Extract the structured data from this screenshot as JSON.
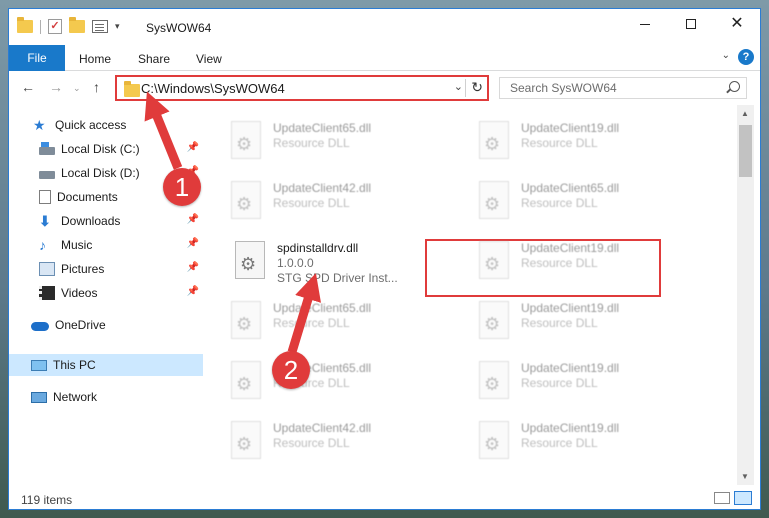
{
  "window": {
    "title": "SysWOW64",
    "controls": {
      "minimize": "—",
      "maximize": "☐",
      "close": "✕"
    }
  },
  "ribbon": {
    "tabs": [
      "File",
      "Home",
      "Share",
      "View"
    ],
    "help": "?"
  },
  "nav": {
    "back": "←",
    "forward": "→",
    "up": "↑",
    "address": "C:\\Windows\\SysWOW64",
    "search_placeholder": "Search SysWOW64"
  },
  "sidebar": {
    "items": [
      {
        "label": "Quick access",
        "icon": "star-icon"
      },
      {
        "label": "Local Disk (C:)",
        "icon": "disk-icon",
        "pinned": true
      },
      {
        "label": "Local Disk (D:)",
        "icon": "disk-icon",
        "pinned": true
      },
      {
        "label": "Documents",
        "icon": "documents-icon",
        "pinned": true
      },
      {
        "label": "Downloads",
        "icon": "downloads-icon",
        "pinned": true
      },
      {
        "label": "Music",
        "icon": "music-icon",
        "pinned": true
      },
      {
        "label": "Pictures",
        "icon": "pictures-icon",
        "pinned": true
      },
      {
        "label": "Videos",
        "icon": "videos-icon",
        "pinned": true
      },
      {
        "label": "OneDrive",
        "icon": "onedrive-icon"
      },
      {
        "label": "This PC",
        "icon": "pc-icon",
        "selected": true
      },
      {
        "label": "Network",
        "icon": "network-icon"
      }
    ]
  },
  "files": {
    "left": [
      {
        "name": "UpdateClient65.dll",
        "line1": "Resource DLL",
        "line2": ""
      },
      {
        "name": "UpdateClient42.dll",
        "line1": "Resource DLL",
        "line2": ""
      },
      {
        "name": "spdinstalldrv.dll",
        "line1": "1.0.0.0",
        "line2": "STG SPD Driver Inst..."
      },
      {
        "name": "UpdateClient65.dll",
        "line1": "Resource DLL",
        "line2": ""
      },
      {
        "name": "UpdateClient65.dll",
        "line1": "Resource DLL",
        "line2": ""
      },
      {
        "name": "UpdateClient42.dll",
        "line1": "Resource DLL",
        "line2": ""
      }
    ],
    "right": [
      {
        "name": "UpdateClient19.dll",
        "line1": "Resource DLL",
        "line2": ""
      },
      {
        "name": "UpdateClient65.dll",
        "line1": "Resource DLL",
        "line2": ""
      },
      {
        "name": "UpdateClient19.dll",
        "line1": "Resource DLL",
        "line2": ""
      },
      {
        "name": "UpdateClient19.dll",
        "line1": "Resource DLL",
        "line2": ""
      },
      {
        "name": "UpdateClient19.dll",
        "line1": "Resource DLL",
        "line2": ""
      },
      {
        "name": "UpdateClient19.dll",
        "line1": "Resource DLL",
        "line2": ""
      }
    ]
  },
  "status": {
    "items_count": "119 items"
  },
  "annotations": {
    "step1": "1",
    "step2": "2",
    "color": "#e03b3b"
  }
}
